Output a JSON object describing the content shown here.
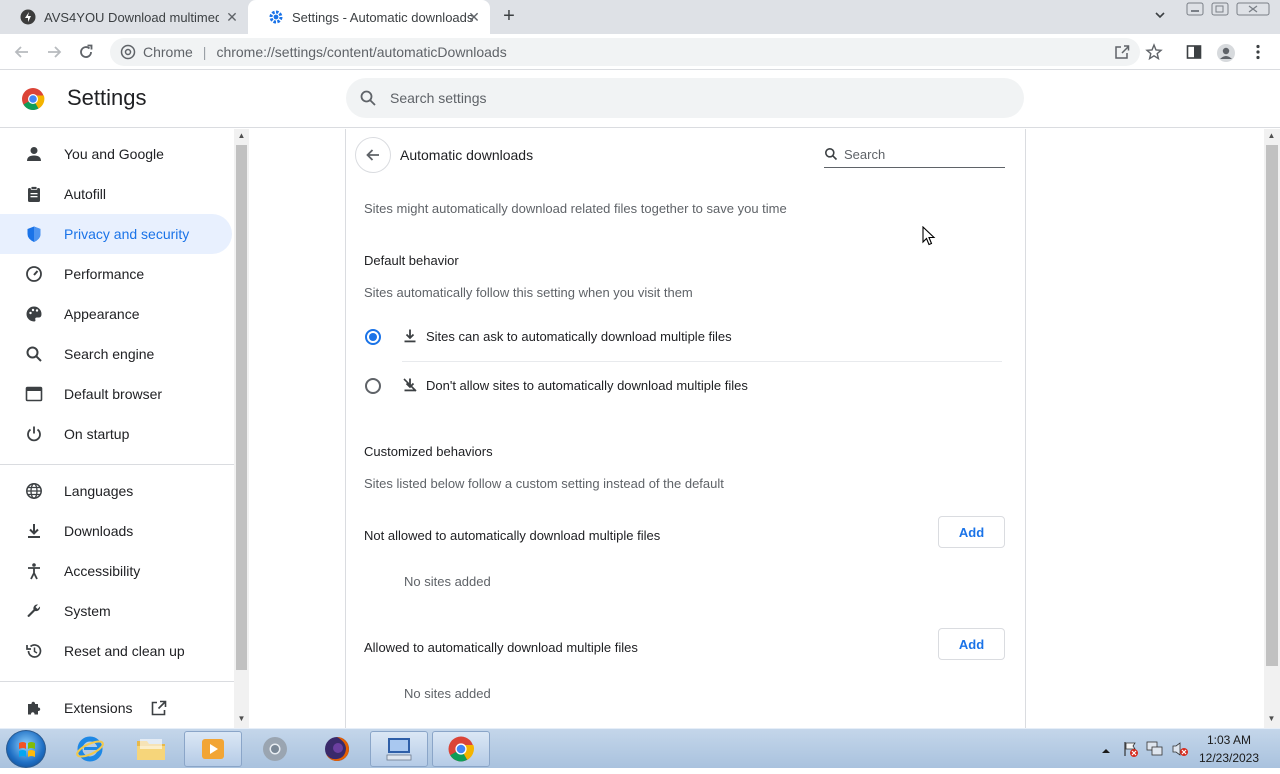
{
  "browser": {
    "tabs": [
      {
        "title": "AVS4YOU Download multimedia",
        "active": false
      },
      {
        "title": "Settings - Automatic downloads",
        "active": true
      }
    ],
    "omnibox": {
      "site_label": "Chrome",
      "separator": "|",
      "url": "chrome://settings/content/automaticDownloads"
    }
  },
  "settings": {
    "title": "Settings",
    "search_placeholder": "Search settings",
    "sidebar": [
      {
        "label": "You and Google",
        "icon": "person-icon"
      },
      {
        "label": "Autofill",
        "icon": "clipboard-icon"
      },
      {
        "label": "Privacy and security",
        "icon": "shield-icon",
        "active": true
      },
      {
        "label": "Performance",
        "icon": "speedometer-icon"
      },
      {
        "label": "Appearance",
        "icon": "palette-icon"
      },
      {
        "label": "Search engine",
        "icon": "search-icon"
      },
      {
        "label": "Default browser",
        "icon": "browser-window-icon"
      },
      {
        "label": "On startup",
        "icon": "power-icon"
      },
      {
        "label": "Languages",
        "icon": "globe-icon"
      },
      {
        "label": "Downloads",
        "icon": "download-icon"
      },
      {
        "label": "Accessibility",
        "icon": "accessibility-icon"
      },
      {
        "label": "System",
        "icon": "wrench-icon"
      },
      {
        "label": "Reset and clean up",
        "icon": "history-icon"
      },
      {
        "label": "Extensions",
        "icon": "puzzle-icon"
      }
    ]
  },
  "page": {
    "heading": "Automatic downloads",
    "search_placeholder": "Search",
    "description": "Sites might automatically download related files together to save you time",
    "default_behavior": {
      "title": "Default behavior",
      "subtitle": "Sites automatically follow this setting when you visit them",
      "options": [
        {
          "label": "Sites can ask to automatically download multiple files",
          "checked": true
        },
        {
          "label": "Don't allow sites to automatically download multiple files",
          "checked": false
        }
      ]
    },
    "customized": {
      "title": "Customized behaviors",
      "subtitle": "Sites listed below follow a custom setting instead of the default",
      "not_allowed": {
        "title": "Not allowed to automatically download multiple files",
        "add": "Add",
        "empty": "No sites added"
      },
      "allowed": {
        "title": "Allowed to automatically download multiple files",
        "add": "Add",
        "empty": "No sites added"
      }
    }
  },
  "taskbar": {
    "time": "1:03 AM",
    "date": "12/23/2023"
  }
}
